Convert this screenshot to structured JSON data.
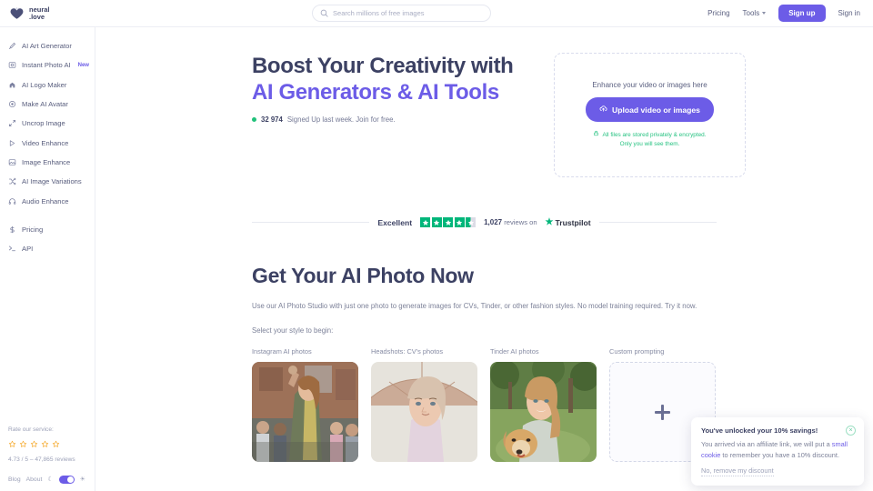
{
  "brand": {
    "line1": "neural",
    "line2": ".love",
    "icon": "heart-logo-icon"
  },
  "search": {
    "placeholder": "Search millions of free images",
    "value": "",
    "icon": "search-icon"
  },
  "topnav": {
    "pricing": "Pricing",
    "tools": "Tools",
    "signup": "Sign up",
    "signin": "Sign in"
  },
  "sidebar": {
    "items": [
      {
        "label": "AI Art Generator",
        "icon": "brush-icon",
        "badge": ""
      },
      {
        "label": "Instant Photo AI",
        "icon": "photo-icon",
        "badge": "New"
      },
      {
        "label": "AI Logo Maker",
        "icon": "logo-icon",
        "badge": ""
      },
      {
        "label": "Make AI Avatar",
        "icon": "avatar-icon",
        "badge": ""
      },
      {
        "label": "Uncrop Image",
        "icon": "expand-icon",
        "badge": ""
      },
      {
        "label": "Video Enhance",
        "icon": "play-icon",
        "badge": ""
      },
      {
        "label": "Image Enhance",
        "icon": "image-icon",
        "badge": ""
      },
      {
        "label": "AI Image Variations",
        "icon": "shuffle-icon",
        "badge": ""
      },
      {
        "label": "Audio Enhance",
        "icon": "headphones-icon",
        "badge": ""
      }
    ],
    "secondary": [
      {
        "label": "Pricing",
        "icon": "dollar-icon"
      },
      {
        "label": "API",
        "icon": "terminal-icon"
      }
    ],
    "rate_label": "Rate our service:",
    "rate_stars": 5,
    "rate_summary": "4.73 / 5 – 47,865 reviews",
    "footer": {
      "blog": "Blog",
      "about": "About",
      "moon": "moon-icon",
      "sun": "sun-icon",
      "theme_on": true
    }
  },
  "hero": {
    "title_line1": "Boost Your Creativity with",
    "title_line2": "AI Generators & AI Tools",
    "signup_count": "32 974",
    "signup_text": "Signed Up last week. Join for free.",
    "upload": {
      "heading": "Enhance your video or images here",
      "button": "Upload video or images",
      "note_line1": "All files are stored privately & encrypted.",
      "note_line2": "Only you will see them."
    }
  },
  "trustpilot": {
    "rating_word": "Excellent",
    "stars": 4.5,
    "reviews_count": "1,027",
    "reviews_text": "reviews on",
    "brand": "Trustpilot"
  },
  "section": {
    "title": "Get Your AI Photo Now",
    "description": "Use our AI Photo Studio with just one photo to generate images for CVs, Tinder, or other fashion styles. No model training required. Try it now.",
    "select_prompt": "Select your style to begin:",
    "cards": [
      {
        "label": "Instagram AI photos",
        "type": "image"
      },
      {
        "label": "Headshots: CV's photos",
        "type": "image"
      },
      {
        "label": "Tinder AI photos",
        "type": "image"
      },
      {
        "label": "Custom prompting",
        "type": "add"
      }
    ]
  },
  "toast": {
    "title": "You've unlocked your 10% savings!",
    "body_part1": "You arrived via an affiliate link, we will put a ",
    "link1": "small cookie",
    "body_part2": " to remember you have a 10% discount.",
    "decline": "No, remove my discount",
    "close": "×"
  },
  "colors": {
    "accent": "#6c5ce7",
    "text_dark": "#3c4163",
    "text_muted": "#7d8299",
    "green": "#21c17a",
    "trustpilot_green": "#00b67a"
  }
}
